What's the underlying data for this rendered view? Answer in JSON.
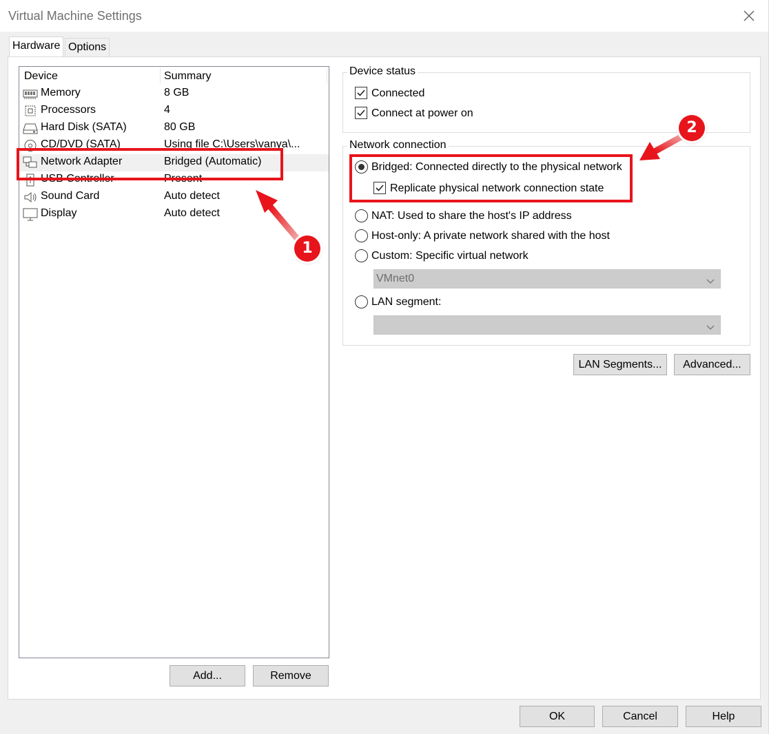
{
  "window": {
    "title": "Virtual Machine Settings",
    "close_icon": "close-icon"
  },
  "tabs": [
    {
      "label": "Hardware",
      "active": true
    },
    {
      "label": "Options",
      "active": false
    }
  ],
  "device_list": {
    "columns": [
      "Device",
      "Summary"
    ],
    "rows": [
      {
        "name": "Memory",
        "summary": "8 GB",
        "icon": "memory-icon"
      },
      {
        "name": "Processors",
        "summary": "4",
        "icon": "processor-icon"
      },
      {
        "name": "Hard Disk (SATA)",
        "summary": "80 GB",
        "icon": "hard-disk-icon"
      },
      {
        "name": "CD/DVD (SATA)",
        "summary": "Using file C:\\Users\\vanya\\...",
        "icon": "cd-dvd-icon"
      },
      {
        "name": "Network Adapter",
        "summary": "Bridged (Automatic)",
        "icon": "network-adapter-icon",
        "selected": true
      },
      {
        "name": "USB Controller",
        "summary": "Present",
        "icon": "usb-icon"
      },
      {
        "name": "Sound Card",
        "summary": "Auto detect",
        "icon": "speaker-icon"
      },
      {
        "name": "Display",
        "summary": "Auto detect",
        "icon": "monitor-icon"
      }
    ],
    "add_label": "Add...",
    "remove_label": "Remove"
  },
  "device_status": {
    "legend": "Device status",
    "connected_label": "Connected",
    "connected_checked": true,
    "power_on_label": "Connect at power on",
    "power_on_checked": true
  },
  "network_connection": {
    "legend": "Network connection",
    "bridged_label": "Bridged: Connected directly to the physical network",
    "replicate_label": "Replicate physical network connection state",
    "replicate_checked": true,
    "nat_label": "NAT: Used to share the host's IP address",
    "hostonly_label": "Host-only: A private network shared with the host",
    "custom_label": "Custom: Specific virtual network",
    "custom_value": "VMnet0",
    "lan_label": "LAN segment:",
    "lan_value": "",
    "selected": "bridged"
  },
  "actions": {
    "lan_segments_label": "LAN Segments...",
    "advanced_label": "Advanced...",
    "ok_label": "OK",
    "cancel_label": "Cancel",
    "help_label": "Help"
  },
  "annotations": {
    "badge1": "1",
    "badge2": "2",
    "color": "#e8141b"
  }
}
